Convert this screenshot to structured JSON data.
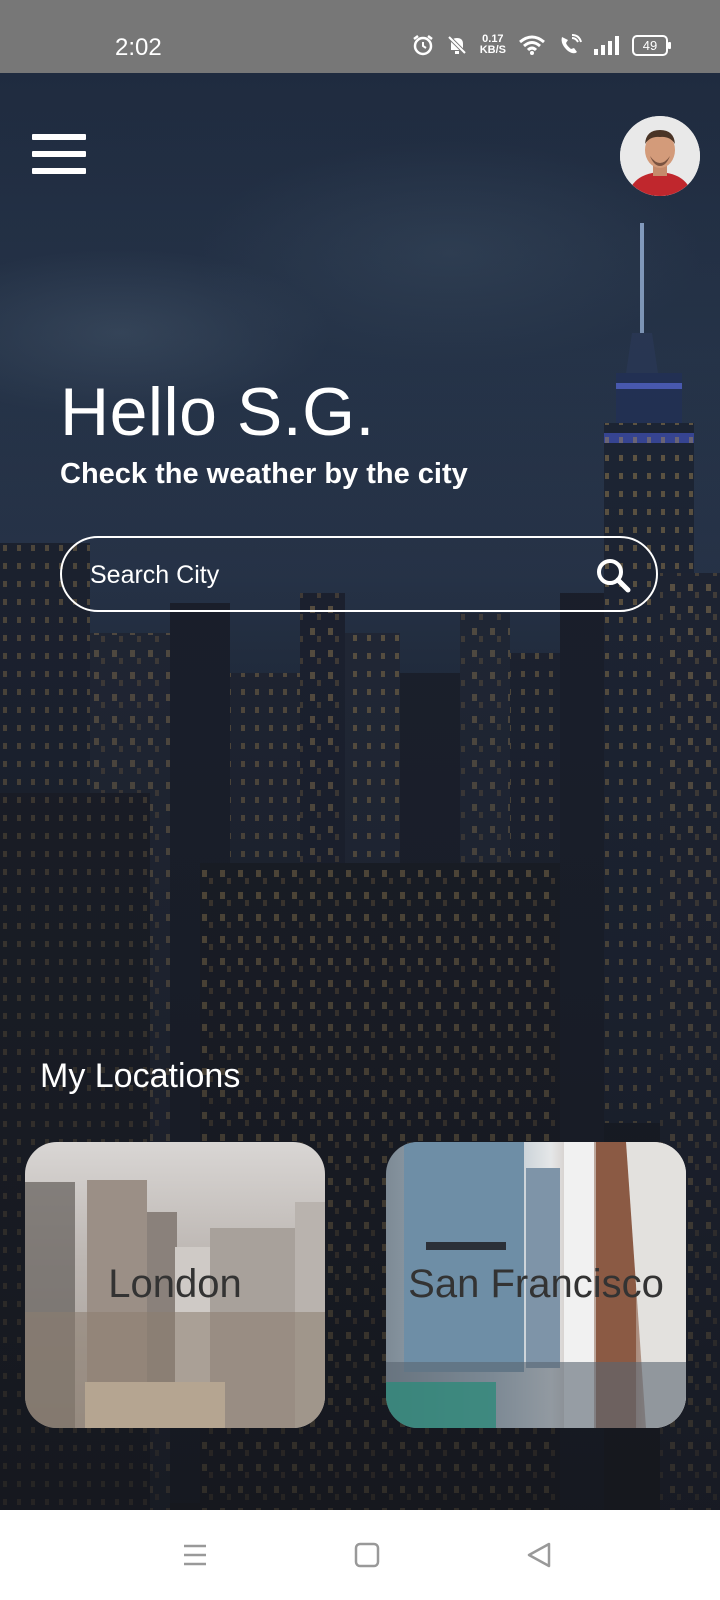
{
  "status_bar": {
    "time": "2:02",
    "net_speed_value": "0.17",
    "net_speed_unit": "KB/S",
    "battery": "49",
    "icons": [
      "alarm-icon",
      "mute-icon",
      "wifi-icon",
      "wifi-call-icon",
      "signal-icon",
      "battery-icon"
    ]
  },
  "header": {
    "menu_icon": "hamburger-menu-icon",
    "avatar": "user-avatar"
  },
  "greeting": {
    "title": "Hello S.G.",
    "subtitle": "Check the weather by the city"
  },
  "search": {
    "placeholder": "Search City",
    "value": "",
    "icon": "search-icon"
  },
  "locations": {
    "title": "My Locations",
    "cards": [
      {
        "label": "London"
      },
      {
        "label": "San Francisco"
      }
    ]
  },
  "nav_bar": {
    "buttons": [
      "recents-icon",
      "home-icon",
      "back-icon"
    ]
  },
  "colors": {
    "status_bar": "#777777",
    "text": "#ffffff",
    "card_label": "#333333"
  }
}
